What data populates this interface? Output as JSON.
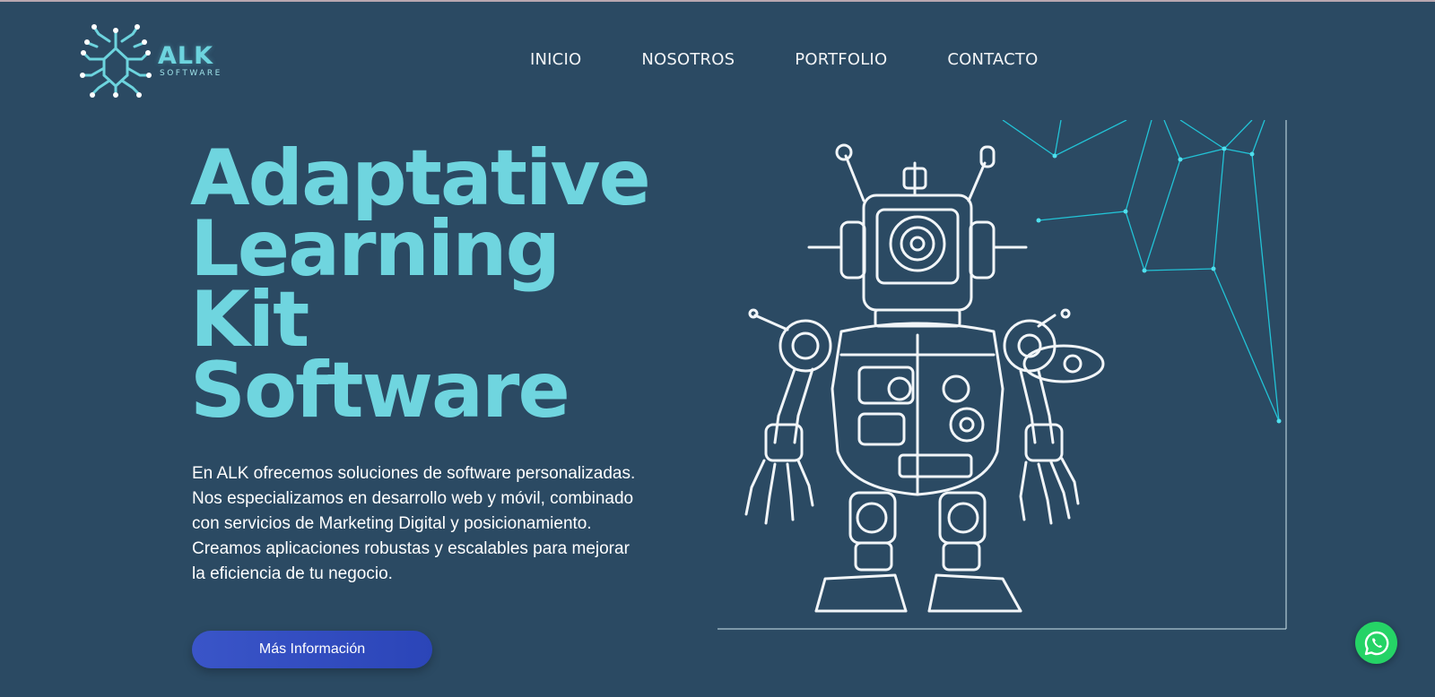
{
  "brand": {
    "name": "ALK",
    "tagline": "SOFTWARE",
    "logo_icon": "circuit-icon",
    "accent_color": "#6fd5df"
  },
  "nav": {
    "items": [
      {
        "label": "INICIO"
      },
      {
        "label": "NOSOTROS"
      },
      {
        "label": "PORTFOLIO"
      },
      {
        "label": "CONTACTO"
      }
    ]
  },
  "hero": {
    "title_lines": [
      "Adaptative",
      "Learning",
      "Kit",
      "Software"
    ],
    "description": "En ALK ofrecemos soluciones de software personalizadas. Nos especializamos en desarrollo web y móvil, combinado con servicios de Marketing Digital y posicionamiento. Creamos aplicaciones robustas y escalables para mejorar la eficiencia de tu negocio.",
    "cta_label": "Más Información"
  },
  "illustration": {
    "subject": "robot-icon"
  },
  "floating": {
    "whatsapp_icon": "whatsapp-icon",
    "whatsapp_color": "#25d366"
  },
  "colors": {
    "background": "#2b4a63",
    "title": "#6fd5df",
    "button": "#2f4bc0"
  }
}
